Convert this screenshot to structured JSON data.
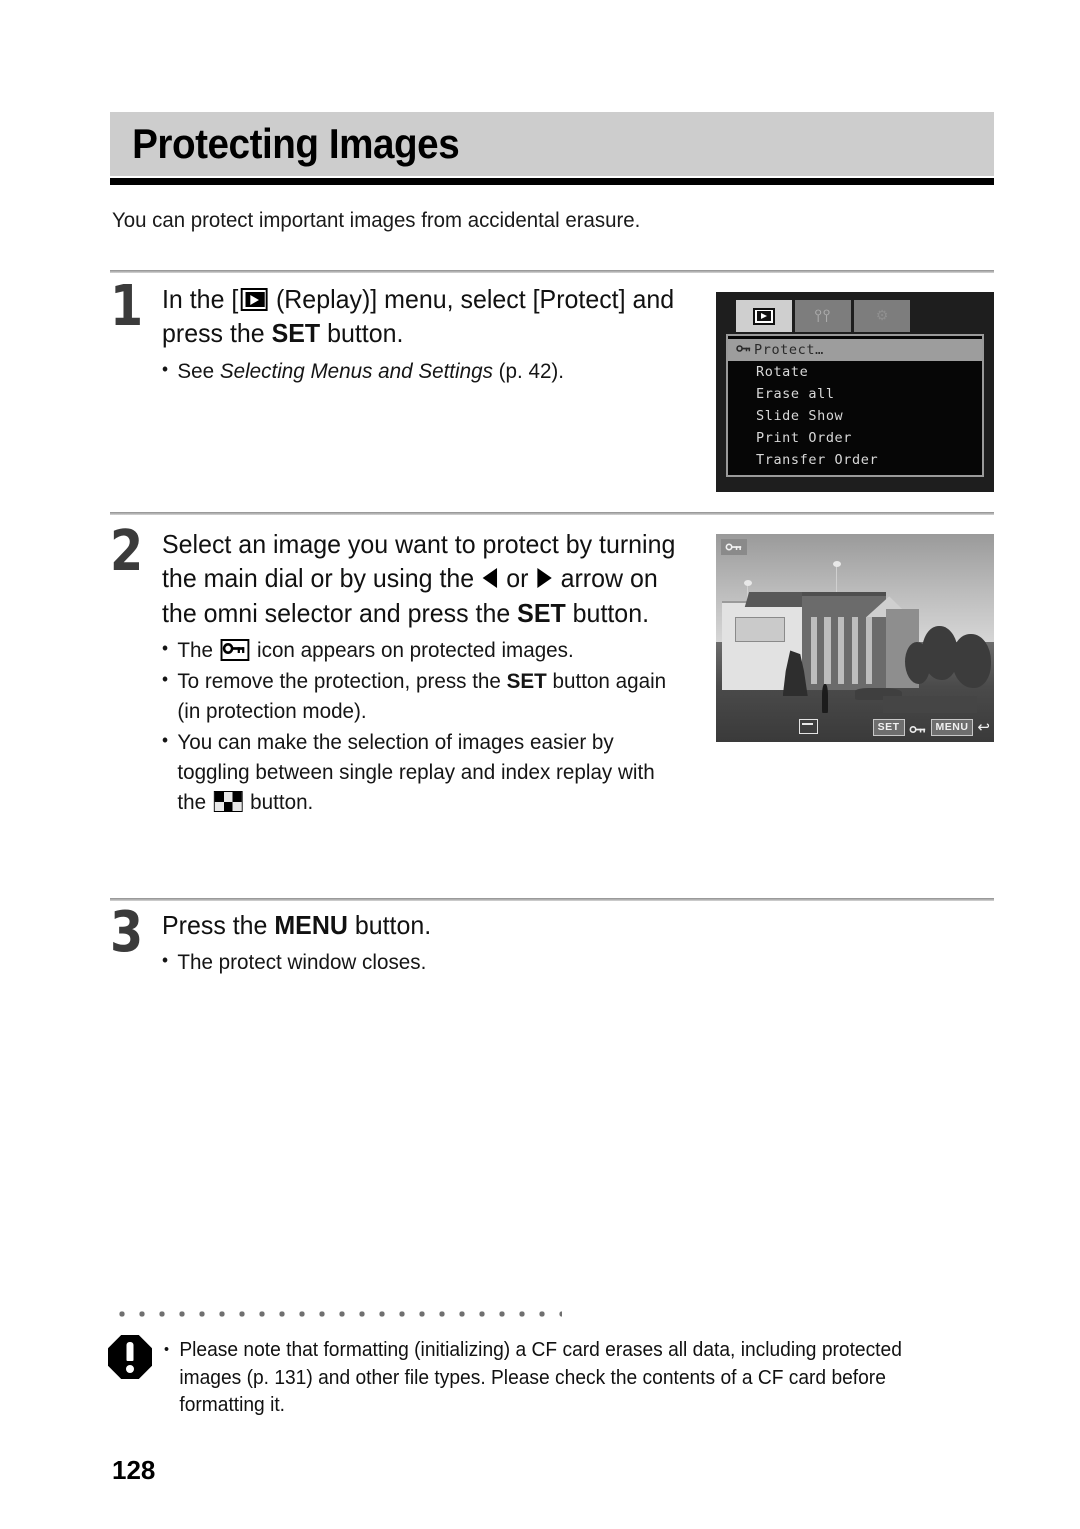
{
  "page": {
    "title": "Protecting Images",
    "intro": "You can protect important images from accidental erasure.",
    "number": "128"
  },
  "steps": [
    {
      "number": "1",
      "head_prefix": "In the [",
      "head_icon": "replay-icon",
      "head_mid": " (Replay)] menu, select [Protect] and press the ",
      "head_bold": "SET",
      "head_suffix": " button.",
      "bullets": [
        {
          "dot": "•",
          "prefix": "See ",
          "italic": "Selecting Menus and Settings",
          "suffix": " (p. 42)."
        }
      ]
    },
    {
      "number": "2",
      "head_a": "Select an image you want to protect by turning the main dial or by using the ",
      "head_icon_left": "triangle-left-icon",
      "head_b": " or ",
      "head_icon_right": "triangle-right-icon",
      "head_c": " arrow on the omni selector and press the ",
      "head_bold": "SET",
      "head_d": " button.",
      "bullets": [
        {
          "dot": "•",
          "prefix": "The ",
          "icon": "key-icon",
          "suffix": " icon appears on protected images."
        },
        {
          "dot": "•",
          "prefix": "To remove the protection, press the ",
          "bold": "SET",
          "suffix": " button again (in protection mode)."
        },
        {
          "dot": "•",
          "prefix": "You can make the selection of images easier by toggling between single replay and index replay with the ",
          "icon": "index-replay-icon",
          "suffix": " button."
        }
      ]
    },
    {
      "number": "3",
      "head_prefix": "Press the ",
      "head_bold": "MENU",
      "head_suffix": " button.",
      "bullets": [
        {
          "dot": "•",
          "text": "The protect window closes."
        }
      ]
    }
  ],
  "lcd_menu": {
    "tabs": [
      {
        "name": "replay-tab",
        "icon": "replay-icon",
        "active": true,
        "glyph": ""
      },
      {
        "name": "tools-tab",
        "icon": "sliders-icon",
        "active": false,
        "glyph": "ᵟᵟ"
      },
      {
        "name": "setup-tab",
        "icon": "setup-icon",
        "active": false,
        "glyph": "⚙"
      }
    ],
    "items": [
      {
        "label": "Protect…",
        "selected": true,
        "has_key_icon": true
      },
      {
        "label": "Rotate",
        "selected": false,
        "has_key_icon": false
      },
      {
        "label": "Erase all",
        "selected": false,
        "has_key_icon": false
      },
      {
        "label": "Slide Show",
        "selected": false,
        "has_key_icon": false
      },
      {
        "label": "Print Order",
        "selected": false,
        "has_key_icon": false
      },
      {
        "label": "Transfer Order",
        "selected": false,
        "has_key_icon": false
      }
    ]
  },
  "lcd_photo": {
    "description": "Black and white photo of a classical building with columns",
    "osd": {
      "protect_badge": "key-icon",
      "set_label": "SET",
      "menu_label": "MENU",
      "back_glyph": "↩"
    }
  },
  "note": {
    "icon": "warning-octagon-icon",
    "dot": "•",
    "text": "Please note that formatting (initializing) a CF card erases all data, including protected images (p. 131) and other file types. Please check the contents of a CF card before formatting it."
  },
  "colors": {
    "header_bg": "#cdcdcd",
    "step_number": "#3b3b3b",
    "rule": "#a0a0a0",
    "lcd_bg": "#1e1e1e"
  }
}
